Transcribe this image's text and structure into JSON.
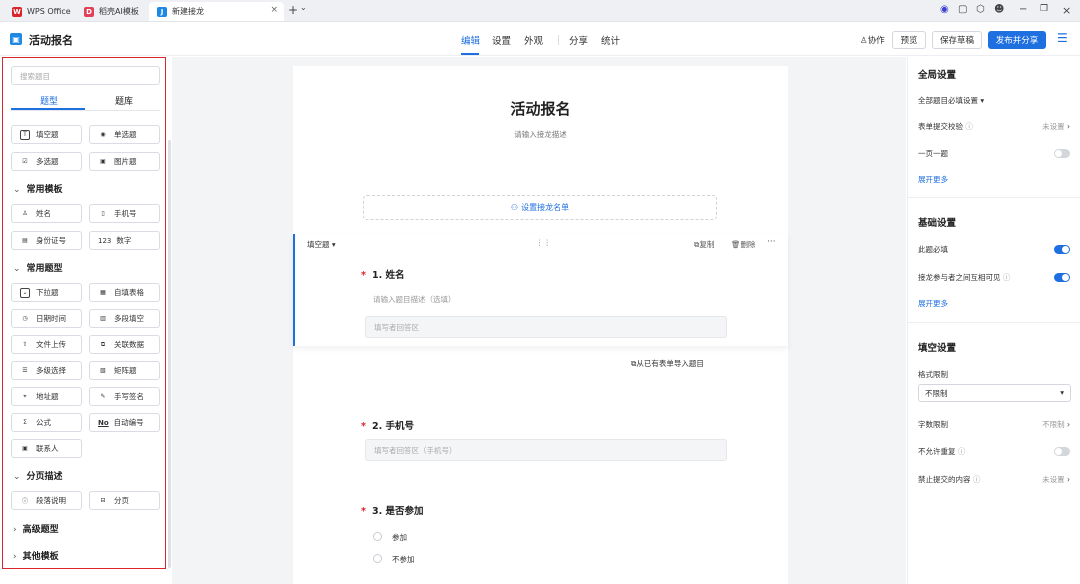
{
  "titlebar": {
    "tabs": [
      {
        "label": "WPS Office",
        "icon": "W",
        "color": "#d9262c"
      },
      {
        "label": "稻壳AI模板",
        "icon": "D",
        "color": "#e0405a"
      },
      {
        "label": "新建接龙",
        "icon": "J",
        "color": "#1e88e5"
      }
    ],
    "new_tab": "+",
    "tab_menu": "⌄"
  },
  "app": {
    "title": "活动报名",
    "nav": [
      "编辑",
      "设置",
      "外观",
      "分享",
      "统计"
    ],
    "collab": "协作",
    "preview": "预览",
    "save_draft": "保存草稿",
    "publish": "发布并分享"
  },
  "left": {
    "search_placeholder": "搜索题目",
    "tabs": [
      "题型",
      "题库"
    ],
    "basic": [
      {
        "label": "填空题",
        "icon": "T"
      },
      {
        "label": "单选题",
        "icon": "◉"
      },
      {
        "label": "多选题",
        "icon": "☑"
      },
      {
        "label": "图片题",
        "icon": "▣"
      }
    ],
    "sections": [
      "常用模板",
      "常用题型",
      "分页描述",
      "高级题型",
      "其他模板"
    ],
    "templates": [
      {
        "label": "姓名",
        "icon": "♙"
      },
      {
        "label": "手机号",
        "icon": "▯"
      },
      {
        "label": "身份证号",
        "icon": "▤"
      },
      {
        "label": "数字",
        "icon": "123"
      }
    ],
    "common": [
      {
        "label": "下拉题",
        "icon": "⌄"
      },
      {
        "label": "自填表格",
        "icon": "▦"
      },
      {
        "label": "日期时间",
        "icon": "◷"
      },
      {
        "label": "多段填空",
        "icon": "▥"
      },
      {
        "label": "文件上传",
        "icon": "⇧"
      },
      {
        "label": "关联数据",
        "icon": "⧉"
      },
      {
        "label": "多级选择",
        "icon": "☰"
      },
      {
        "label": "矩阵题",
        "icon": "▧"
      },
      {
        "label": "地址题",
        "icon": "⌖"
      },
      {
        "label": "手写签名",
        "icon": "✎"
      },
      {
        "label": "公式",
        "icon": "Σ"
      },
      {
        "label": "自动编号",
        "icon": "No"
      },
      {
        "label": "联系人",
        "icon": "▣"
      }
    ],
    "paging": [
      {
        "label": "段落说明",
        "icon": "ⓘ"
      },
      {
        "label": "分页",
        "icon": "⊟"
      }
    ]
  },
  "form": {
    "title": "活动报名",
    "desc": "请输入接龙描述",
    "namelist": "设置接龙名单",
    "active_type": "填空题",
    "copy": "复制",
    "delete": "删除",
    "more": "···",
    "drag": "⋮⋮",
    "q1": {
      "label": "1. 姓名",
      "hint": "请输入题目描述（选填）",
      "placeholder": "填写者回答区"
    },
    "import": "从已有表单导入题目",
    "q2": {
      "label": "2. 手机号",
      "placeholder": "填写者回答区（手机号）"
    },
    "q3": {
      "label": "3. 是否参加",
      "options": [
        "参加",
        "不参加"
      ]
    }
  },
  "right": {
    "global": {
      "title": "全局设置",
      "all_required": "全部题目必填设置",
      "submit_check": "表单提交校验",
      "submit_check_val": "未设置",
      "one_page": "一页一题",
      "more": "展开更多"
    },
    "basic": {
      "title": "基础设置",
      "required": "此题必填",
      "visible": "接龙参与者之间互相可见",
      "more": "展开更多"
    },
    "fill": {
      "title": "填空设置",
      "format": "格式限制",
      "format_val": "不限制",
      "length": "字数限制",
      "length_val": "不限制",
      "nodup": "不允许重复",
      "forbid": "禁止提交的内容",
      "forbid_val": "未设置"
    }
  }
}
